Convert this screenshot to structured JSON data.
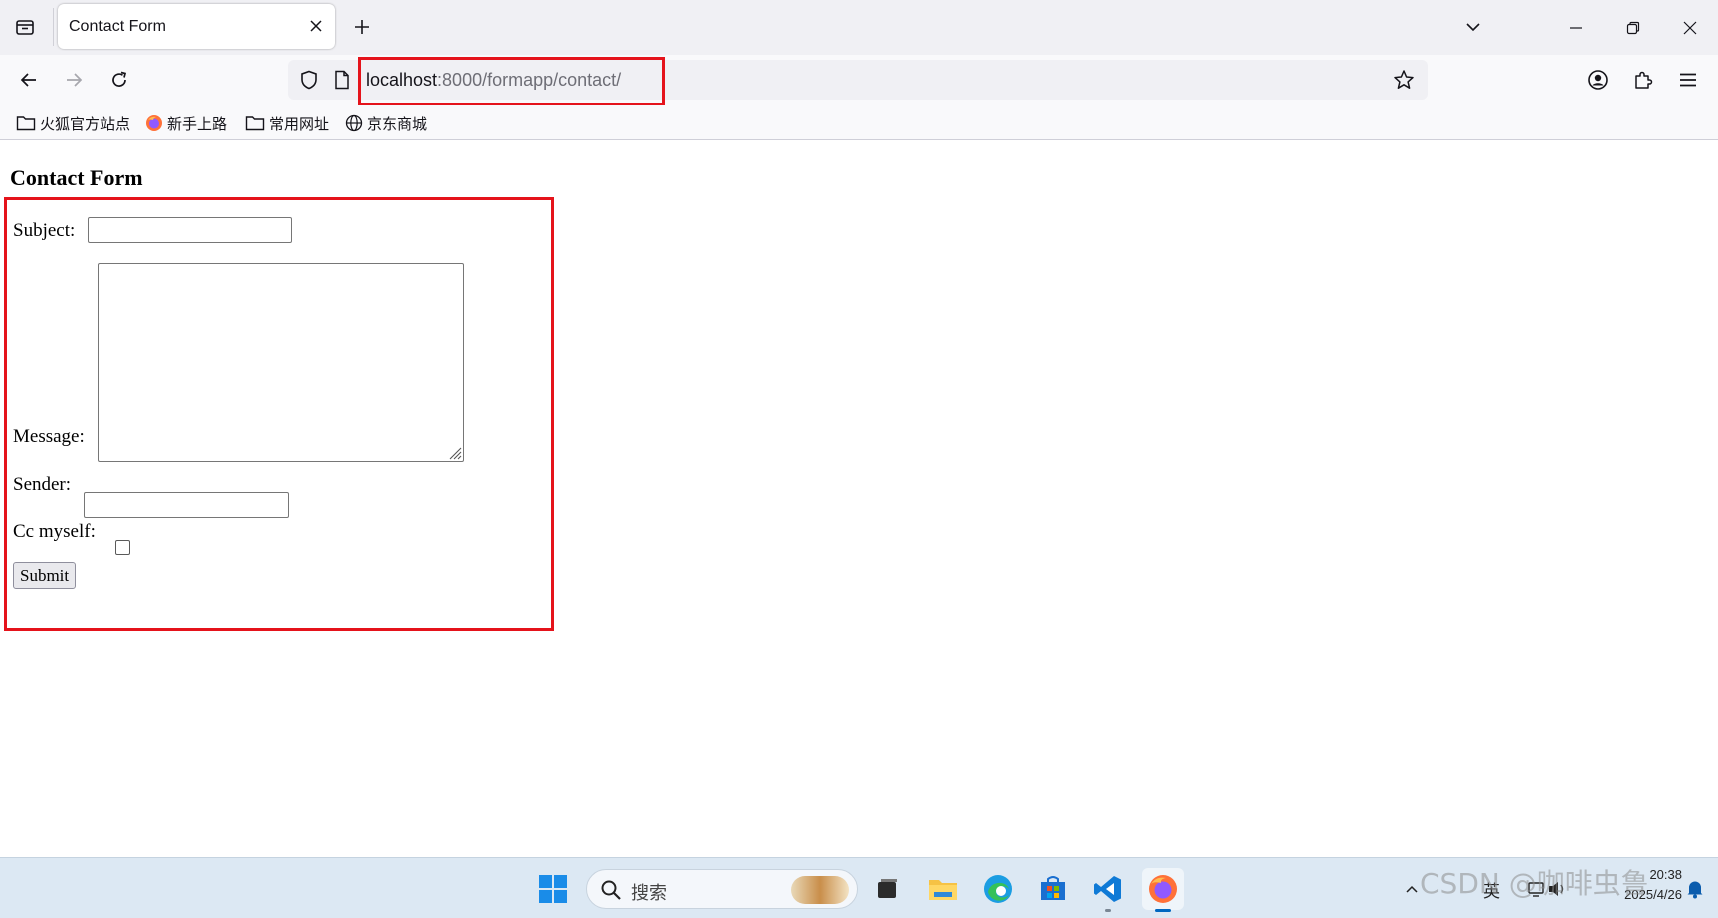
{
  "browser": {
    "tab": {
      "title": "Contact Form"
    },
    "url": {
      "host": "localhost",
      "rest": ":8000/formapp/contact/"
    },
    "bookmarks": [
      {
        "label": "火狐官方站点",
        "icon": "folder-icon"
      },
      {
        "label": "新手上路",
        "icon": "firefox-icon"
      },
      {
        "label": "常用网址",
        "icon": "folder-icon"
      },
      {
        "label": "京东商城",
        "icon": "globe-icon"
      }
    ]
  },
  "page": {
    "title": "Contact Form",
    "form": {
      "subject_label": "Subject:",
      "subject_value": "",
      "message_label": "Message:",
      "message_value": "",
      "sender_label": "Sender:",
      "sender_value": "",
      "cc_label": "Cc myself:",
      "cc_checked": false,
      "submit_label": "Submit"
    }
  },
  "taskbar": {
    "search_placeholder": "搜索",
    "tray_lang": "英",
    "clock_time": "20:38",
    "clock_date": "2025/4/26",
    "watermark": "CSDN @咖啡虫鲁"
  },
  "colors": {
    "highlight": "#e5131b",
    "tabstrip_bg": "#f0f0f4",
    "taskbar_bg": "#dce8f3",
    "accent": "#0067c0"
  }
}
